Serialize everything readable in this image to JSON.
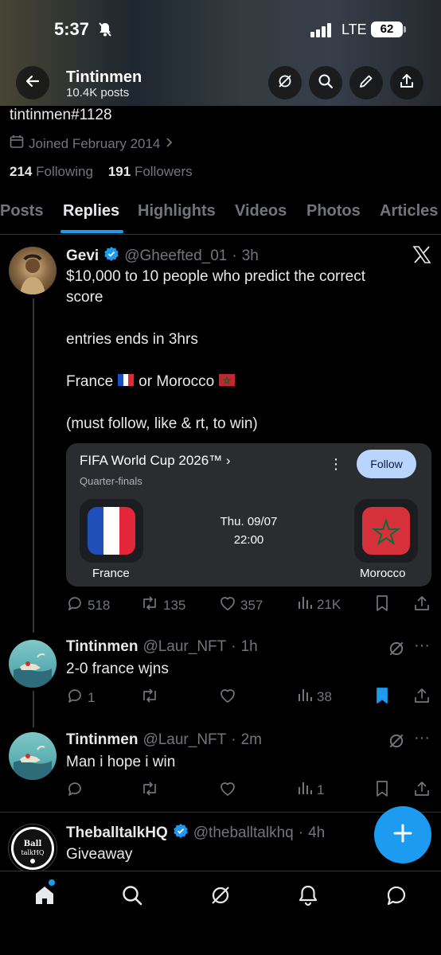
{
  "status_bar": {
    "time": "5:37",
    "network": "LTE",
    "battery": "62"
  },
  "header": {
    "name": "Tintinmen",
    "posts_count": "10.4K posts"
  },
  "profile": {
    "handle_line": "tintinmen#1128",
    "joined": "Joined February 2014",
    "following_count": "214",
    "following_label": "Following",
    "followers_count": "191",
    "followers_label": "Followers"
  },
  "tabs": [
    "Posts",
    "Replies",
    "Highlights",
    "Videos",
    "Photos",
    "Articles"
  ],
  "active_tab": "Replies",
  "tweets": [
    {
      "name": "Gevi",
      "handle": "@Gheefted_01",
      "time": "3h",
      "lines": [
        "$10,000 to 10 people who predict the correct",
        "score",
        "entries ends in 3hrs",
        "France",
        "or Morocco",
        "(must follow, like & rt, to win)"
      ],
      "card": {
        "title": "FIFA World Cup 2026™ ›",
        "subtitle": "Quarter-finals",
        "follow_label": "Follow",
        "date": "Thu. 09/07",
        "time": "22:00",
        "home_team": "France",
        "away_team": "Morocco"
      },
      "stats": {
        "replies": "518",
        "reposts": "135",
        "likes": "357",
        "views": "21K"
      }
    },
    {
      "name": "Tintinmen",
      "handle": "@Laur_NFT",
      "time": "1h",
      "text": "2-0 france wjns",
      "stats": {
        "replies": "1",
        "reposts": "",
        "likes": "",
        "views": "38"
      }
    },
    {
      "name": "Tintinmen",
      "handle": "@Laur_NFT",
      "time": "2m",
      "text": "Man i hope i win",
      "stats": {
        "replies": "",
        "reposts": "",
        "likes": "",
        "views": "1"
      }
    },
    {
      "name": "TheballtalkHQ",
      "handle": "@theballtalkhq",
      "time": "4h",
      "text": "Giveaway",
      "avatar_text": "THE Ball talkHQ"
    }
  ],
  "colors": {
    "accent": "#1d9bf0",
    "muted": "#71767b",
    "text": "#e7e9ea",
    "background": "#000000"
  },
  "icons": {
    "header": [
      "back-arrow-icon",
      "grok-icon",
      "search-icon",
      "edit-icon",
      "share-icon"
    ],
    "bottom_nav": [
      "home-icon",
      "search-icon",
      "grok-icon",
      "notifications-icon",
      "messages-icon"
    ]
  }
}
